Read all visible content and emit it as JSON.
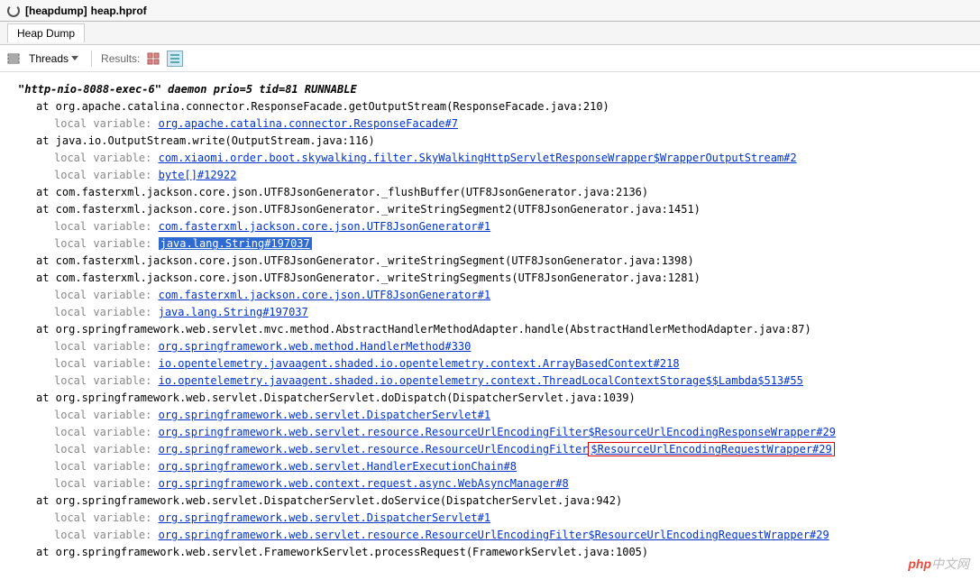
{
  "window": {
    "title_prefix": "[heapdump]",
    "title_file": "heap.hprof"
  },
  "tab": {
    "label": "Heap Dump"
  },
  "toolbar": {
    "threads_label": "Threads",
    "results_label": "Results:"
  },
  "thread": {
    "header": "\"http-nio-8088-exec-6\" daemon prio=5 tid=81 RUNNABLE"
  },
  "frames": [
    {
      "at": "at org.apache.catalina.connector.ResponseFacade.getOutputStream(ResponseFacade.java:210)",
      "locals": [
        {
          "link": "org.apache.catalina.connector.ResponseFacade#7"
        }
      ]
    },
    {
      "at": "at java.io.OutputStream.write(OutputStream.java:116)",
      "locals": [
        {
          "link": "com.xiaomi.order.boot.skywalking.filter.SkyWalkingHttpServletResponseWrapper$WrapperOutputStream#2"
        },
        {
          "link": "byte[]#12922"
        }
      ]
    },
    {
      "at": "at com.fasterxml.jackson.core.json.UTF8JsonGenerator._flushBuffer(UTF8JsonGenerator.java:2136)",
      "locals": []
    },
    {
      "at": "at com.fasterxml.jackson.core.json.UTF8JsonGenerator._writeStringSegment2(UTF8JsonGenerator.java:1451)",
      "locals": [
        {
          "link": "com.fasterxml.jackson.core.json.UTF8JsonGenerator#1"
        },
        {
          "link": "java.lang.String#197037",
          "highlighted": true
        }
      ]
    },
    {
      "at": "at com.fasterxml.jackson.core.json.UTF8JsonGenerator._writeStringSegment(UTF8JsonGenerator.java:1398)",
      "locals": []
    },
    {
      "at": "at com.fasterxml.jackson.core.json.UTF8JsonGenerator._writeStringSegments(UTF8JsonGenerator.java:1281)",
      "locals": [
        {
          "link": "com.fasterxml.jackson.core.json.UTF8JsonGenerator#1"
        },
        {
          "link": "java.lang.String#197037"
        }
      ]
    },
    {
      "at": "at org.springframework.web.servlet.mvc.method.AbstractHandlerMethodAdapter.handle(AbstractHandlerMethodAdapter.java:87)",
      "locals": [
        {
          "link": "org.springframework.web.method.HandlerMethod#330"
        },
        {
          "link": "io.opentelemetry.javaagent.shaded.io.opentelemetry.context.ArrayBasedContext#218"
        },
        {
          "link": "io.opentelemetry.javaagent.shaded.io.opentelemetry.context.ThreadLocalContextStorage$$Lambda$513#55"
        }
      ]
    },
    {
      "at": "at org.springframework.web.servlet.DispatcherServlet.doDispatch(DispatcherServlet.java:1039)",
      "locals": [
        {
          "link": "org.springframework.web.servlet.DispatcherServlet#1"
        },
        {
          "link": "org.springframework.web.servlet.resource.ResourceUrlEncodingFilter$ResourceUrlEncodingResponseWrapper#29"
        },
        {
          "link_pre": "org.springframework.web.servlet.resource.ResourceUrlEncodingFilter",
          "link_boxed": "$ResourceUrlEncodingRequestWrapper#29",
          "redbox": true
        },
        {
          "link": "org.springframework.web.servlet.HandlerExecutionChain#8"
        },
        {
          "link": "org.springframework.web.context.request.async.WebAsyncManager#8"
        }
      ]
    },
    {
      "at": "at org.springframework.web.servlet.DispatcherServlet.doService(DispatcherServlet.java:942)",
      "locals": [
        {
          "link": "org.springframework.web.servlet.DispatcherServlet#1"
        },
        {
          "link": "org.springframework.web.servlet.resource.ResourceUrlEncodingFilter$ResourceUrlEncodingRequestWrapper#29"
        }
      ]
    },
    {
      "at": "at org.springframework.web.servlet.FrameworkServlet.processRequest(FrameworkServlet.java:1005)",
      "locals": []
    }
  ],
  "labels": {
    "local_variable": "local variable:"
  },
  "watermark": {
    "php": "php",
    "cn": "中文网"
  }
}
